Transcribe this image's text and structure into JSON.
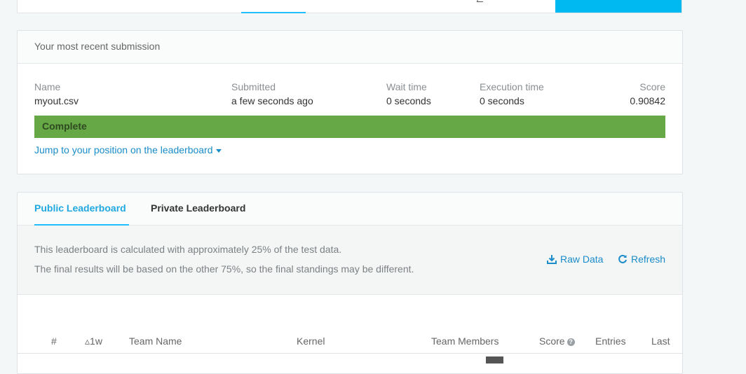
{
  "submission": {
    "title": "Your most recent submission",
    "labels": {
      "name": "Name",
      "submitted": "Submitted",
      "wait_time": "Wait time",
      "execution_time": "Execution time",
      "score": "Score"
    },
    "values": {
      "name": "myout.csv",
      "submitted": "a few seconds ago",
      "wait_time": "0 seconds",
      "execution_time": "0 seconds",
      "score": "0.90842"
    },
    "status": "Complete",
    "status_color": "#66a845",
    "jump_link": "Jump to your position on the leaderboard"
  },
  "leaderboard": {
    "tabs": {
      "public": "Public Leaderboard",
      "private": "Private Leaderboard"
    },
    "info_line1": "This leaderboard is calculated with approximately 25% of the test data.",
    "info_line2": "The final results will be based on the other 75%, so the final standings may be different.",
    "raw_data": "Raw Data",
    "refresh": "Refresh",
    "columns": {
      "rank": "#",
      "delta": "▵1w",
      "team_name": "Team Name",
      "kernel": "Kernel",
      "team_members": "Team Members",
      "score": "Score",
      "entries": "Entries",
      "last": "Last"
    }
  },
  "colors": {
    "accent": "#20beff",
    "link": "#1a8cc9",
    "cta": "#00b9f1"
  }
}
